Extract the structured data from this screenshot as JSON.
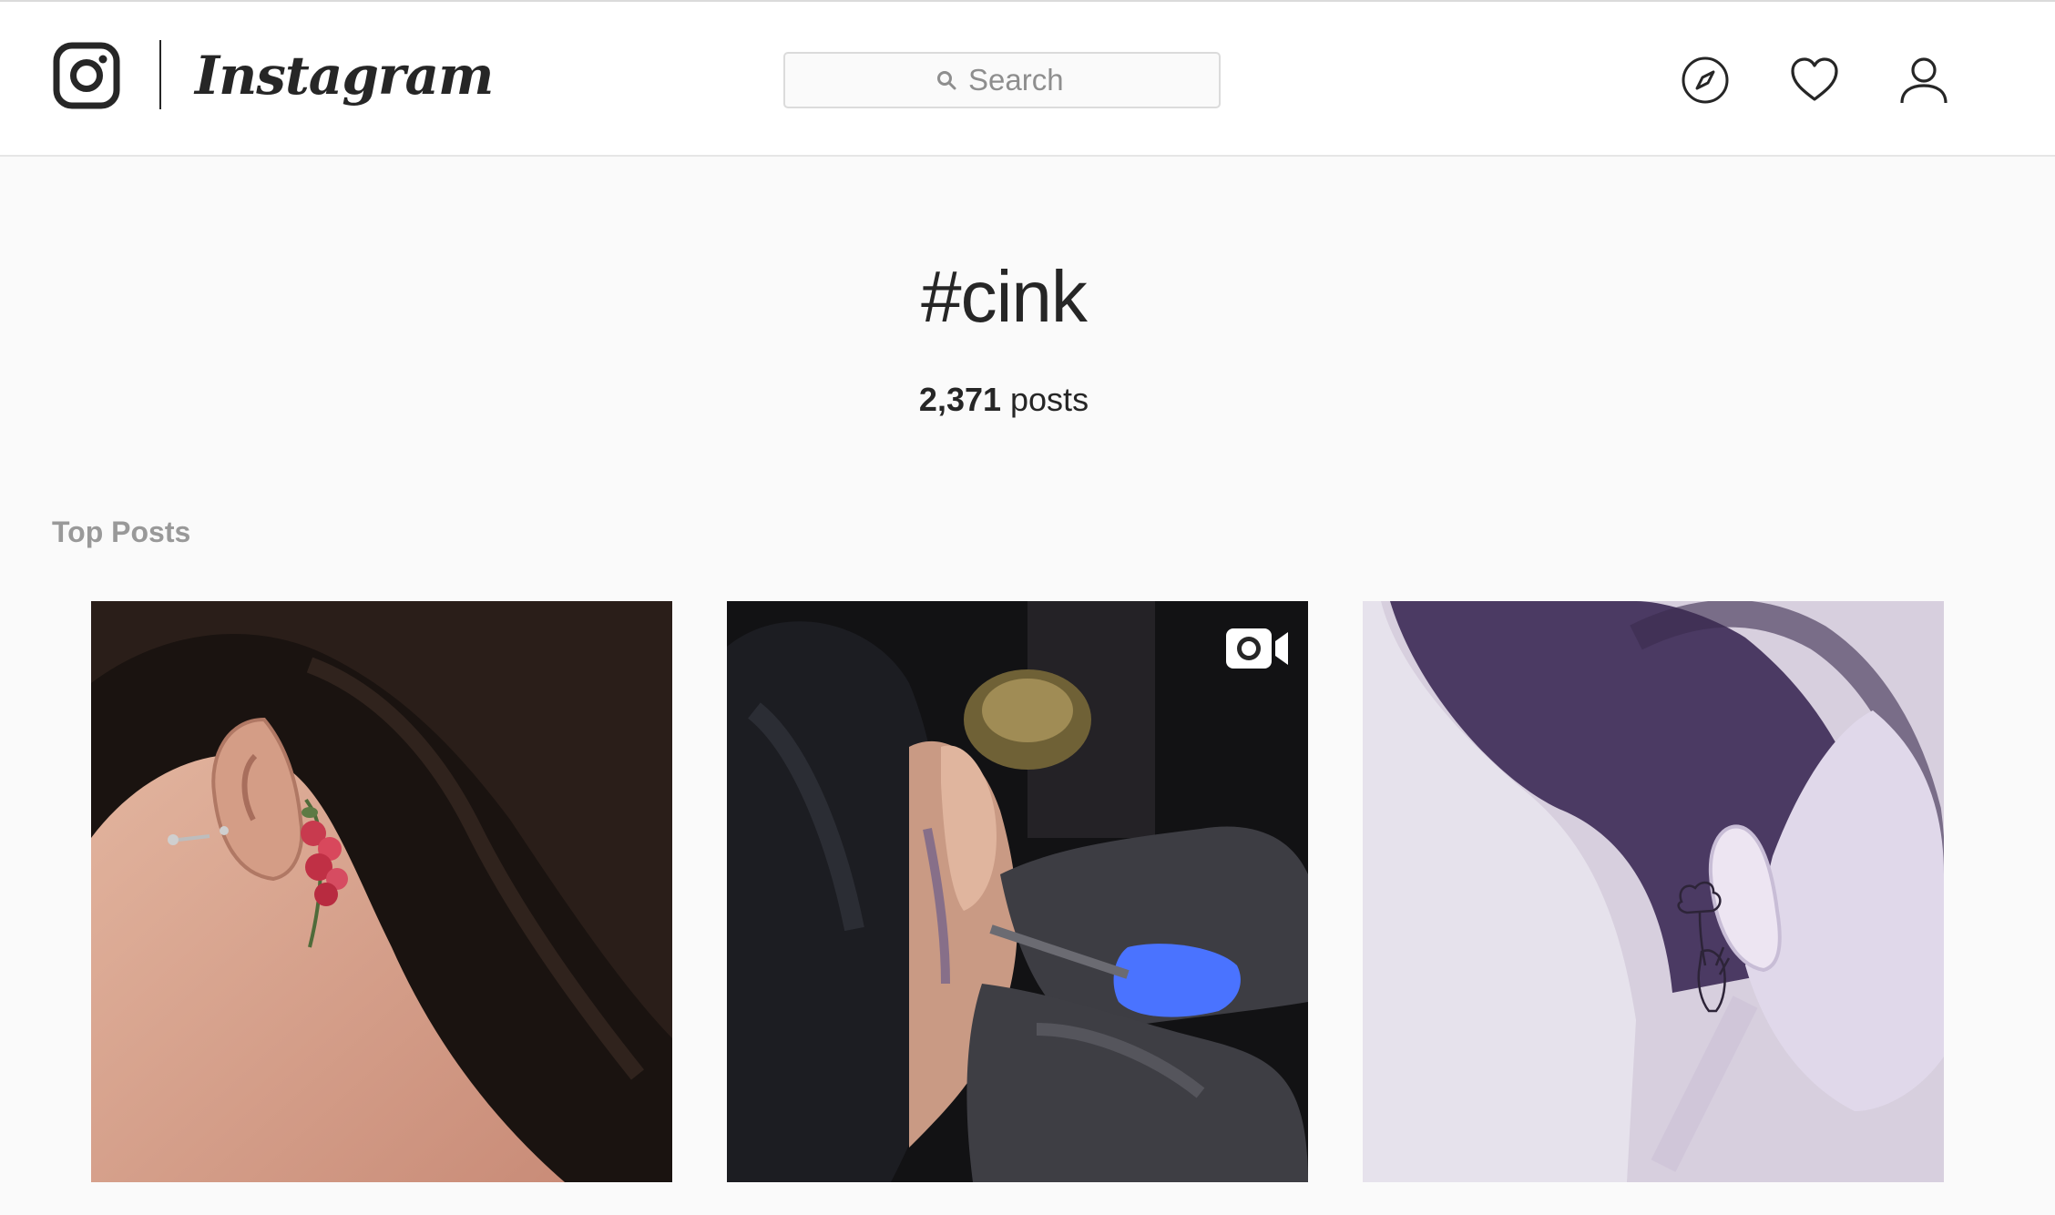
{
  "header": {
    "brand": "Instagram",
    "search": {
      "placeholder": "Search",
      "value": ""
    },
    "nav_icons": [
      "compass-icon",
      "heart-icon",
      "user-icon"
    ]
  },
  "hashtag_page": {
    "tag": "#cink",
    "post_count": "2,371",
    "post_count_suffix": " posts",
    "section_title": "Top Posts"
  },
  "posts": [
    {
      "kind": "image",
      "subject": "flower-tattoo-behind-ear"
    },
    {
      "kind": "video",
      "subject": "tattoo-being-applied"
    },
    {
      "kind": "image",
      "subject": "line-art-hand-tattoo"
    }
  ],
  "colors": {
    "background": "#fafafa",
    "header_bg": "#ffffff",
    "border": "#dbdbdb",
    "text_primary": "#262626",
    "text_muted": "#8e8e8e",
    "section_label": "#999999"
  }
}
